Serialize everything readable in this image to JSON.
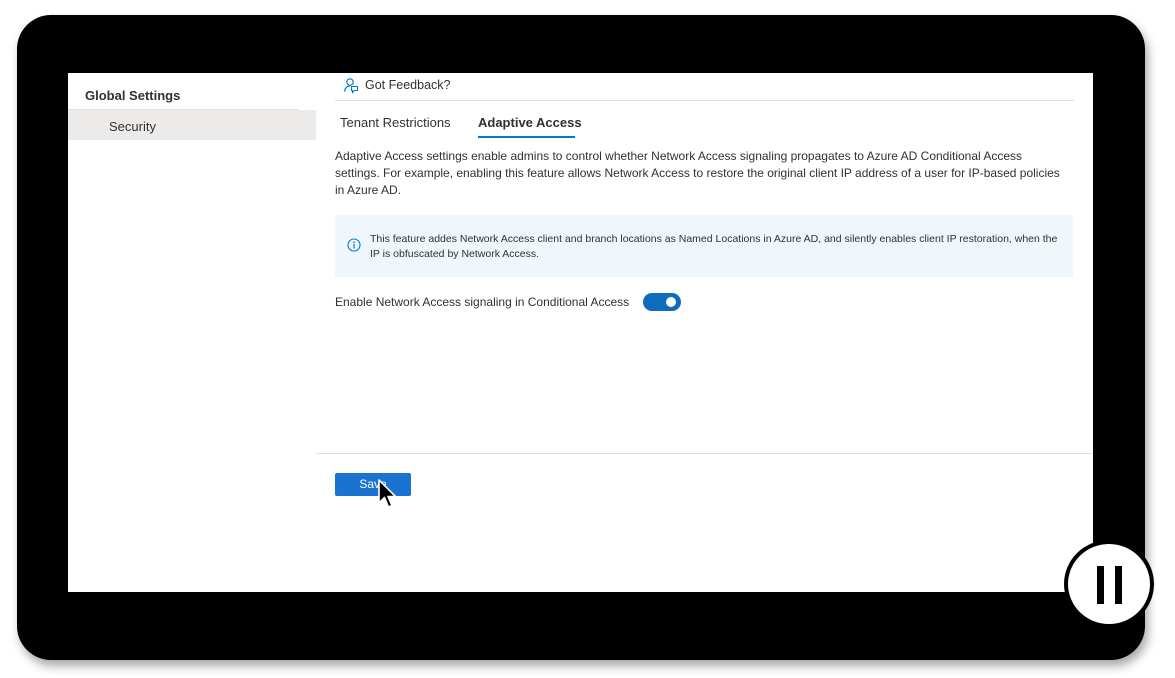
{
  "sidebar": {
    "heading": "Global Settings",
    "items": [
      {
        "label": "Security",
        "selected": true
      }
    ]
  },
  "feedback": {
    "icon": "feedback-icon",
    "label": "Got Feedback?"
  },
  "tabs": [
    {
      "label": "Tenant Restrictions",
      "selected": false
    },
    {
      "label": "Adaptive Access",
      "selected": true
    }
  ],
  "description": "Adaptive Access settings enable admins to control whether Network Access signaling propagates to Azure AD Conditional Access settings. For example, enabling this feature allows Network Access to restore the original client IP address of a user for IP-based policies in Azure AD.",
  "info_bar": {
    "icon": "info-icon",
    "text": "This feature addes Network Access client and branch locations as Named Locations in Azure AD, and silently enables client IP restoration, when the IP is obfuscated by Network Access."
  },
  "signaling_toggle": {
    "label": "Enable Network Access signaling in Conditional Access",
    "state": "on"
  },
  "footer": {
    "save_label": "Save"
  },
  "colors": {
    "accent": "#0078d4",
    "button": "#1a73d1",
    "info_background": "#eff6fc",
    "selected_nav": "#edebe9"
  },
  "overlay": {
    "pause_icon": "pause-icon",
    "cursor_icon": "mouse-pointer-icon"
  }
}
